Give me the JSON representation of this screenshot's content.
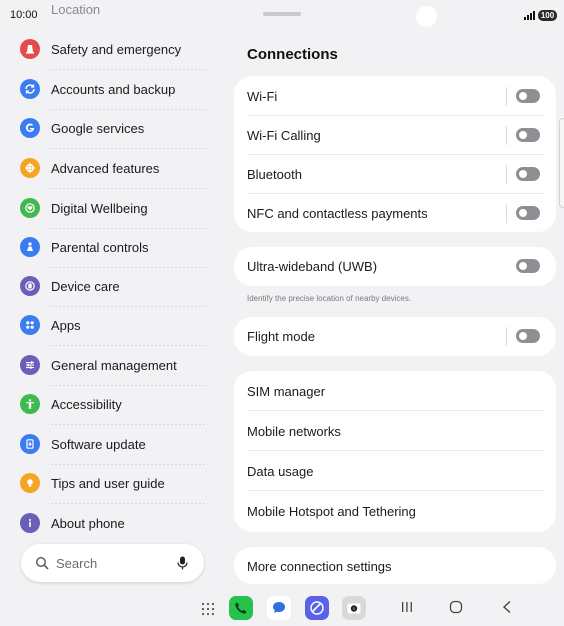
{
  "status_bar": {
    "time": "10:00",
    "battery": "100"
  },
  "left_pane": {
    "partial_item": "Location",
    "items": [
      {
        "label": "Safety and emergency",
        "icon": "alert-icon",
        "color": "#e44c4c"
      },
      {
        "label": "Accounts and backup",
        "icon": "sync-icon",
        "color": "#3b7cf0"
      },
      {
        "label": "Google services",
        "icon": "google-icon",
        "color": "#3b7cf0"
      },
      {
        "label": "Advanced features",
        "icon": "gear-plus-icon",
        "color": "#f5a524"
      },
      {
        "label": "Digital Wellbeing",
        "icon": "heart-icon",
        "color": "#3fb950"
      },
      {
        "label": "Parental controls",
        "icon": "family-icon",
        "color": "#3b7cf0"
      },
      {
        "label": "Device care",
        "icon": "device-care-icon",
        "color": "#6a5fb8"
      },
      {
        "label": "Apps",
        "icon": "apps-grid-icon",
        "color": "#3b7cf0"
      },
      {
        "label": "General management",
        "icon": "sliders-icon",
        "color": "#6a5fb8"
      },
      {
        "label": "Accessibility",
        "icon": "accessibility-icon",
        "color": "#3fb950"
      },
      {
        "label": "Software update",
        "icon": "software-update-icon",
        "color": "#3b7cf0"
      },
      {
        "label": "Tips and user guide",
        "icon": "lightbulb-icon",
        "color": "#f5a524"
      },
      {
        "label": "About phone",
        "icon": "info-icon",
        "color": "#6a5fb8"
      }
    ],
    "search": {
      "placeholder": "Search"
    }
  },
  "right_pane": {
    "title": "Connections",
    "card1": [
      {
        "label": "Wi-Fi",
        "toggle": "off"
      },
      {
        "label": "Wi-Fi Calling",
        "toggle": "off"
      },
      {
        "label": "Bluetooth",
        "toggle": "off"
      },
      {
        "label": "NFC and contactless payments",
        "toggle": "off"
      }
    ],
    "uwb": {
      "label": "Ultra-wideband (UWB)",
      "toggle": "off",
      "hint": "Identify the precise location of nearby devices."
    },
    "flight": {
      "label": "Flight mode",
      "toggle": "off"
    },
    "card3": [
      {
        "label": "SIM manager"
      },
      {
        "label": "Mobile networks"
      },
      {
        "label": "Data usage"
      },
      {
        "label": "Mobile Hotspot and Tethering"
      }
    ],
    "more": {
      "label": "More connection settings"
    }
  },
  "dock": {
    "apps": [
      {
        "name": "Phone",
        "icon": "phone-icon",
        "color": "#27c24c"
      },
      {
        "name": "Messages",
        "icon": "messages-icon",
        "color": "#2f6fe0"
      },
      {
        "name": "Internet",
        "icon": "internet-icon",
        "color": "#5a63e8"
      },
      {
        "name": "Camera",
        "icon": "camera-icon",
        "color": "#d9d9dc"
      }
    ]
  }
}
